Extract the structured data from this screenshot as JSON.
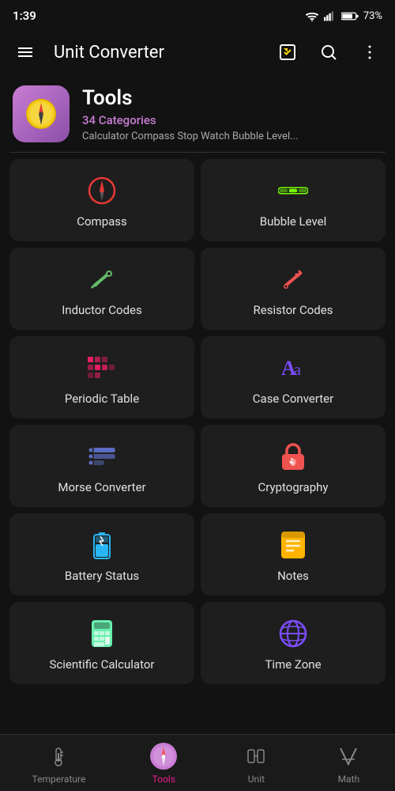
{
  "statusBar": {
    "time": "1:39",
    "battery": "73%"
  },
  "appBar": {
    "menuLabel": "menu",
    "title": "Unit Converter",
    "favoritesLabel": "favorites",
    "searchLabel": "search",
    "moreLabel": "more"
  },
  "category": {
    "name": "Tools",
    "count": "34 Categories",
    "description": "Calculator Compass Stop Watch Bubble Level..."
  },
  "gridItems": [
    {
      "id": "compass",
      "label": "Compass",
      "iconColor": "#e53935",
      "iconType": "compass"
    },
    {
      "id": "bubble-level",
      "label": "Bubble Level",
      "iconColor": "#76ff03",
      "iconType": "bubble"
    },
    {
      "id": "inductor-codes",
      "label": "Inductor Codes",
      "iconColor": "#66bb6a",
      "iconType": "inductor"
    },
    {
      "id": "resistor-codes",
      "label": "Resistor Codes",
      "iconColor": "#ef5350",
      "iconType": "resistor"
    },
    {
      "id": "periodic-table",
      "label": "Periodic Table",
      "iconColor": "#e91e63",
      "iconType": "periodic"
    },
    {
      "id": "case-converter",
      "label": "Case Converter",
      "iconColor": "#7c4dff",
      "iconType": "text"
    },
    {
      "id": "morse-converter",
      "label": "Morse Converter",
      "iconColor": "#5c6bc0",
      "iconType": "morse"
    },
    {
      "id": "cryptography",
      "label": "Cryptography",
      "iconColor": "#ef5350",
      "iconType": "lock"
    },
    {
      "id": "battery-status",
      "label": "Battery Status",
      "iconColor": "#29b6f6",
      "iconType": "battery"
    },
    {
      "id": "notes",
      "label": "Notes",
      "iconColor": "#ffb300",
      "iconType": "notes"
    },
    {
      "id": "scientific-calculator",
      "label": "Scientific Calculator",
      "iconColor": "#69f0ae",
      "iconType": "calc"
    },
    {
      "id": "time-zone",
      "label": "Time Zone",
      "iconColor": "#7c4dff",
      "iconType": "globe"
    }
  ],
  "bottomNav": [
    {
      "id": "temperature",
      "label": "Temperature",
      "active": false
    },
    {
      "id": "tools",
      "label": "Tools",
      "active": true
    },
    {
      "id": "unit",
      "label": "Unit",
      "active": false
    },
    {
      "id": "math",
      "label": "Math",
      "active": false
    }
  ]
}
